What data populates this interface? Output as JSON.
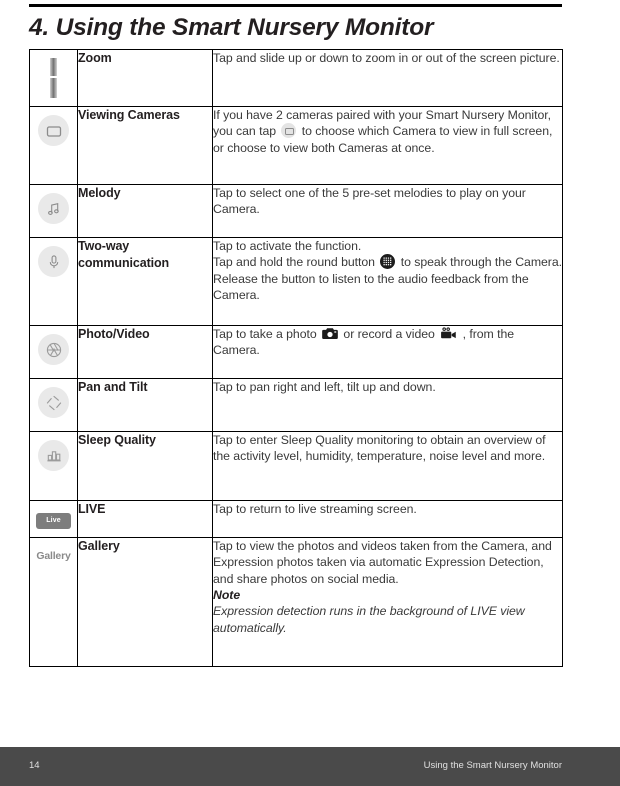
{
  "page": {
    "title": "4. Using the Smart Nursery Monitor",
    "footer_page_number": "14",
    "footer_title": "Using the Smart Nursery Monitor",
    "footer_bg": "#4a4a4a",
    "rule_color": "#000000"
  },
  "table": {
    "rows": [
      {
        "icon": "zoom-slider-icon",
        "name": "Zoom",
        "description": "Tap and slide up or down to zoom in or out of the screen picture."
      },
      {
        "icon": "screen-rectangle-icon",
        "name": "Viewing Cameras",
        "desc_part1": "If you have 2 cameras paired with your Smart Nursery Monitor, you can tap",
        "inline_icon": "screen-rectangle-inline-icon",
        "desc_part2": "to choose which Camera to view in full screen, or choose to view both Cameras at once."
      },
      {
        "icon": "music-note-icon",
        "name": "Melody",
        "description": "Tap to select one of the 5 pre-set melodies to play on your Camera."
      },
      {
        "icon": "microphone-icon",
        "name": "Two-way communication",
        "line1": "Tap to activate the function.",
        "line2a": "Tap and hold the round button",
        "inline_icon": "speaker-grille-inline-icon",
        "line2b": "to speak through the Camera.",
        "line3": "Release the button to listen to the audio feedback from the Camera."
      },
      {
        "icon": "aperture-icon",
        "name": "Photo/Video",
        "desc_part1": "Tap to take a photo",
        "inline_icon_1": "photo-camera-inline-icon",
        "desc_part2": "or record a video",
        "inline_icon_2": "video-camera-inline-icon",
        "desc_part3": ", from the Camera."
      },
      {
        "icon": "pan-tilt-diamond-icon",
        "name": "Pan and Tilt",
        "description": "Tap to pan right and left, tilt up and down."
      },
      {
        "icon": "bar-chart-icon",
        "name": "Sleep Quality",
        "description": "Tap to enter Sleep Quality monitoring to obtain an overview of the activity level, humidity, temperature, noise level and more."
      },
      {
        "icon": "live-badge-icon",
        "icon_label": "Live",
        "name": "LIVE",
        "description": "Tap to return to live streaming screen."
      },
      {
        "icon": "gallery-text-icon",
        "icon_label": "Gallery",
        "name": "Gallery",
        "description": "Tap to view the photos and videos taken from the Camera, and Expression photos taken via automatic Expression Detection, and share photos on social media.",
        "note_title": "Note",
        "note_body": "Expression detection runs in the background of LIVE view automatically."
      }
    ]
  }
}
